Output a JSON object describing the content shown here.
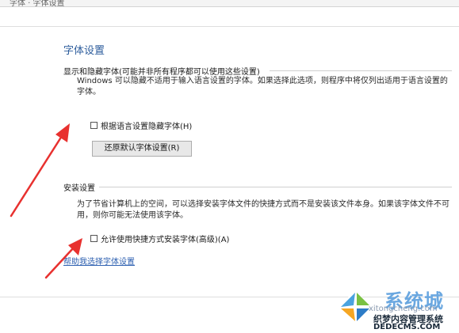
{
  "header": {
    "fragment_text": "字体 · 字体设置"
  },
  "font_settings": {
    "title": "字体设置",
    "hide_group": {
      "label": "显示和隐藏字体(可能并非所有程序都可以使用这些设置)",
      "description": "Windows 可以隐藏不适用于输入语言设置的字体。如果选择此选项，则程序中将仅列出适用于语言设置的字体。",
      "checkbox_label": "根据语言设置隐藏字体(H)",
      "checkbox_checked": false,
      "restore_button_label": "还原默认字体设置(R)"
    },
    "install_group": {
      "label": "安装设置",
      "description": "为了节省计算机上的空间，可以选择安装字体文件的快捷方式而不是安装该文件本身。如果该字体文件不可用，则你可能无法使用该字体。",
      "checkbox_label": "允许使用快捷方式安装字体(高级)(A)",
      "checkbox_checked": false
    },
    "help_link": "帮助我选择字体设置"
  },
  "annotation": {
    "arrow_color": "#e8312f"
  },
  "watermark": {
    "brand": "系统城",
    "sub": "xitongcheng.com",
    "line1": "织梦内容管理系统",
    "line2": "DEDECMS.COM"
  },
  "colors": {
    "title_blue": "#2d5d9c",
    "link_blue": "#2c5fb0",
    "watermark_blue": "#6aa7e0"
  }
}
